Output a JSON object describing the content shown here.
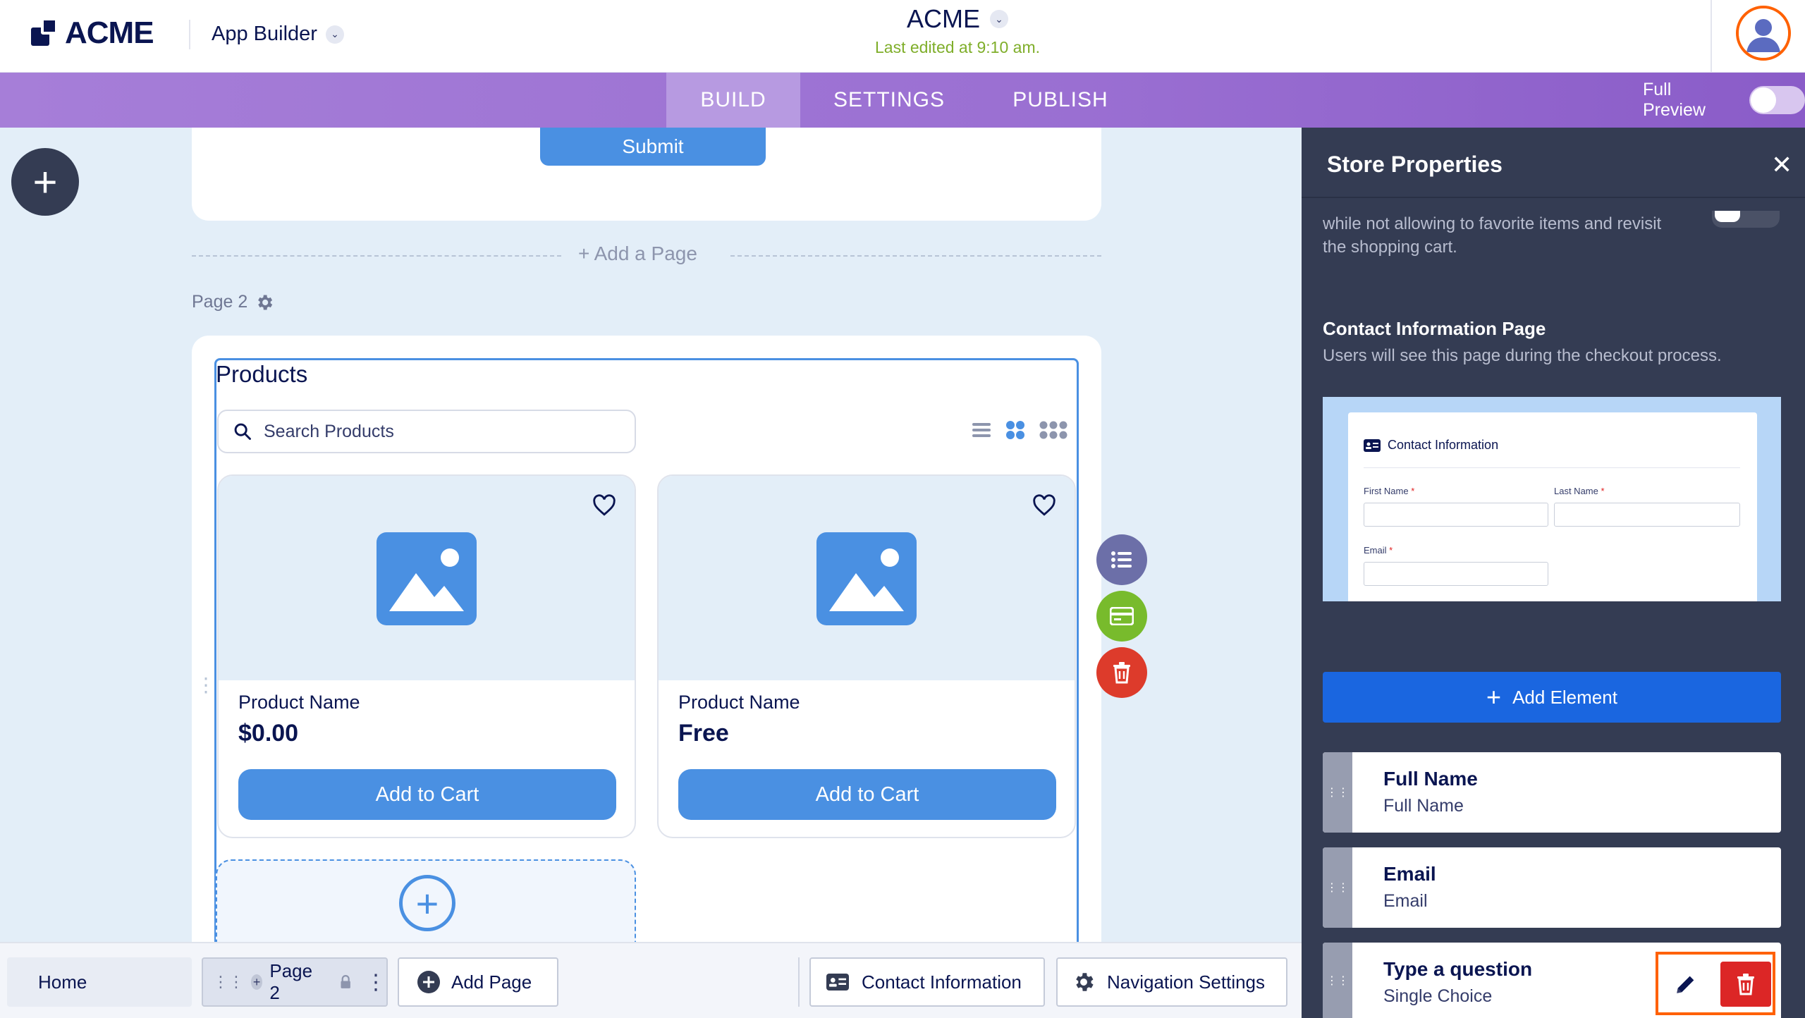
{
  "header": {
    "logo_text": "ACME",
    "app_builder_label": "App Builder",
    "app_name": "ACME",
    "last_edited": "Last edited at 9:10 am."
  },
  "nav": {
    "tabs": [
      {
        "label": "BUILD",
        "active": true
      },
      {
        "label": "SETTINGS",
        "active": false
      },
      {
        "label": "PUBLISH",
        "active": false
      }
    ],
    "full_preview_label": "Full Preview"
  },
  "canvas": {
    "submit_label": "Submit",
    "add_page_label": "+  Add a Page",
    "page_label": "Page 2",
    "products_title": "Products",
    "search_placeholder": "Search Products",
    "products": [
      {
        "name": "Product Name",
        "price": "$0.00",
        "button": "Add to Cart"
      },
      {
        "name": "Product Name",
        "price": "Free",
        "button": "Add to Cart"
      }
    ]
  },
  "panel": {
    "title": "Store Properties",
    "desc_cut": "while not allowing to favorite items and revisit the shopping cart.",
    "section_title": "Contact Information Page",
    "section_sub": "Users will see this page during the checkout process.",
    "preview": {
      "title": "Contact Information",
      "first_name": "First Name",
      "last_name": "Last Name",
      "email": "Email",
      "required_mark": "*"
    },
    "add_element_label": "Add Element",
    "fields": [
      {
        "title": "Full Name",
        "sub": "Full Name"
      },
      {
        "title": "Email",
        "sub": "Email"
      },
      {
        "title": "Type a question",
        "sub": "Single Choice"
      }
    ]
  },
  "bottom": {
    "home_label": "Home",
    "page2_label": "Page 2",
    "add_page_label": "Add Page",
    "contact_label": "Contact Information",
    "nav_settings_label": "Navigation Settings"
  },
  "colors": {
    "accent_blue": "#4a90e2",
    "nav_purple": "#9a6fd2",
    "panel_dark": "#343c53",
    "highlight_orange": "#ff6100",
    "delete_red": "#dc2626",
    "edited_green": "#7fae2a"
  }
}
